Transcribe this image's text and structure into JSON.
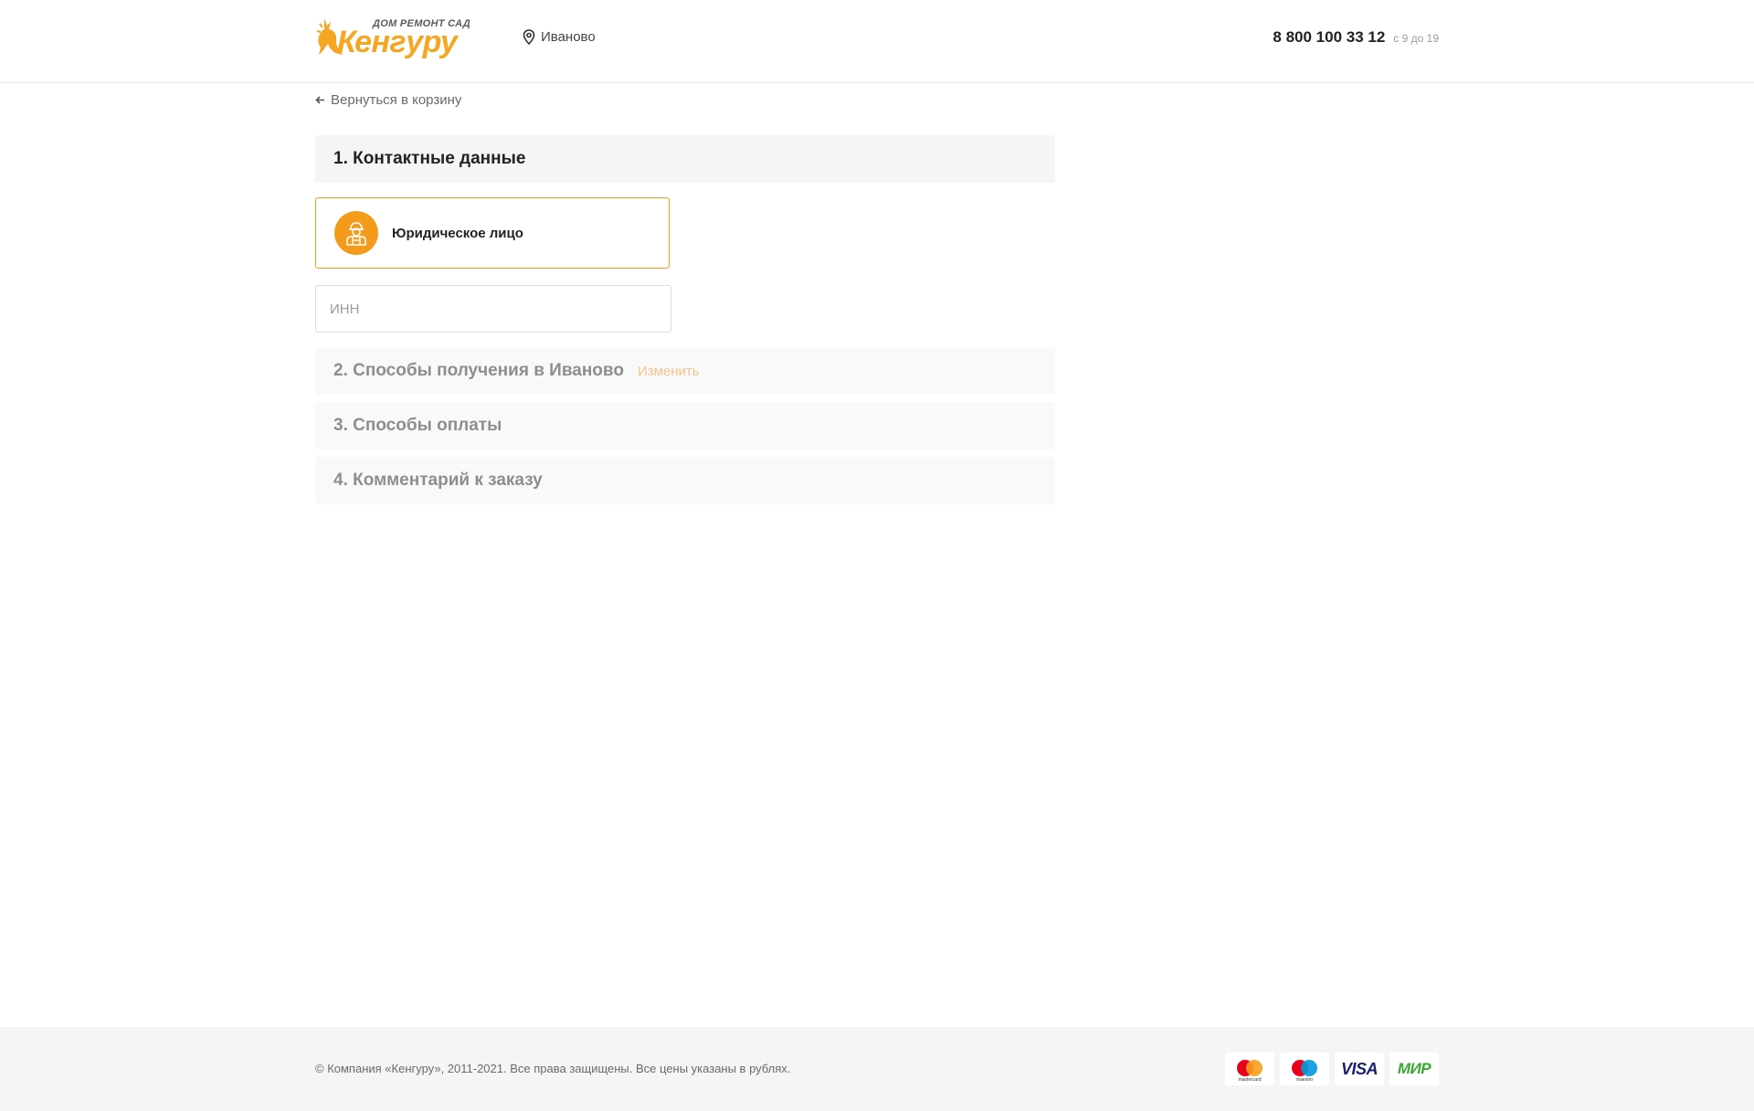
{
  "header": {
    "logo": {
      "tagline": "ДОМ РЕМОНТ САД",
      "name": "Кенгуру"
    },
    "city": "Иваново",
    "phone": "8 800 100 33 12",
    "hours": "с 9 до 19"
  },
  "back_link": "Вернуться в корзину",
  "sections": {
    "contacts": {
      "title": "1. Контактные данные"
    },
    "delivery": {
      "title": "2. Способы получения в Иваново",
      "change_label": "Изменить"
    },
    "payment": {
      "title": "3. Способы оплаты"
    },
    "comment": {
      "title": "4. Комментарий к заказу"
    }
  },
  "customer_type": {
    "label": "Юридическое лицо"
  },
  "inn": {
    "placeholder": "ИНН",
    "value": ""
  },
  "footer": {
    "copyright": "© Компания «Кенгуру», 2011-2021. Все права защищены. Все цены указаны в рублях.",
    "payments": {
      "mastercard": "mastercard",
      "maestro": "maestro",
      "visa": "VISA",
      "mir": "МИР"
    }
  },
  "colors": {
    "accent": "#f59b1c",
    "logo": "#f5a623",
    "muted": "#8e8e8e"
  }
}
